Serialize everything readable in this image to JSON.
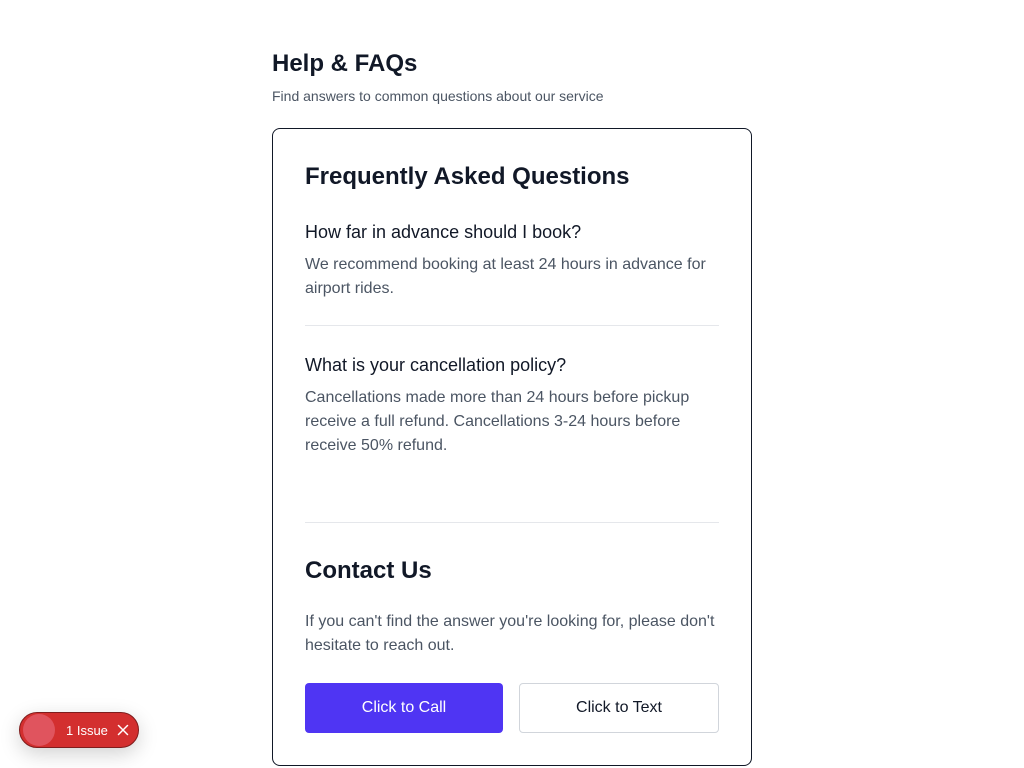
{
  "header": {
    "title": "Help & FAQs",
    "subtitle": "Find answers to common questions about our service"
  },
  "faq": {
    "title": "Frequently Asked Questions",
    "items": [
      {
        "question": "How far in advance should I book?",
        "answer": "We recommend booking at least 24 hours in advance for airport rides."
      },
      {
        "question": "What is your cancellation policy?",
        "answer": "Cancellations made more than 24 hours before pickup receive a full refund. Cancellations 3-24 hours before receive 50% refund."
      }
    ]
  },
  "contact": {
    "title": "Contact Us",
    "text": "If you can't find the answer you're looking for, please don't hesitate to reach out.",
    "call_label": "Click to Call",
    "text_label": "Click to Text"
  },
  "issue_badge": {
    "label": "1 Issue",
    "icon": "close-icon"
  },
  "colors": {
    "primary": "#4f35f3",
    "issue": "#d32f2f",
    "text": "#111827",
    "muted": "#4b5563"
  }
}
